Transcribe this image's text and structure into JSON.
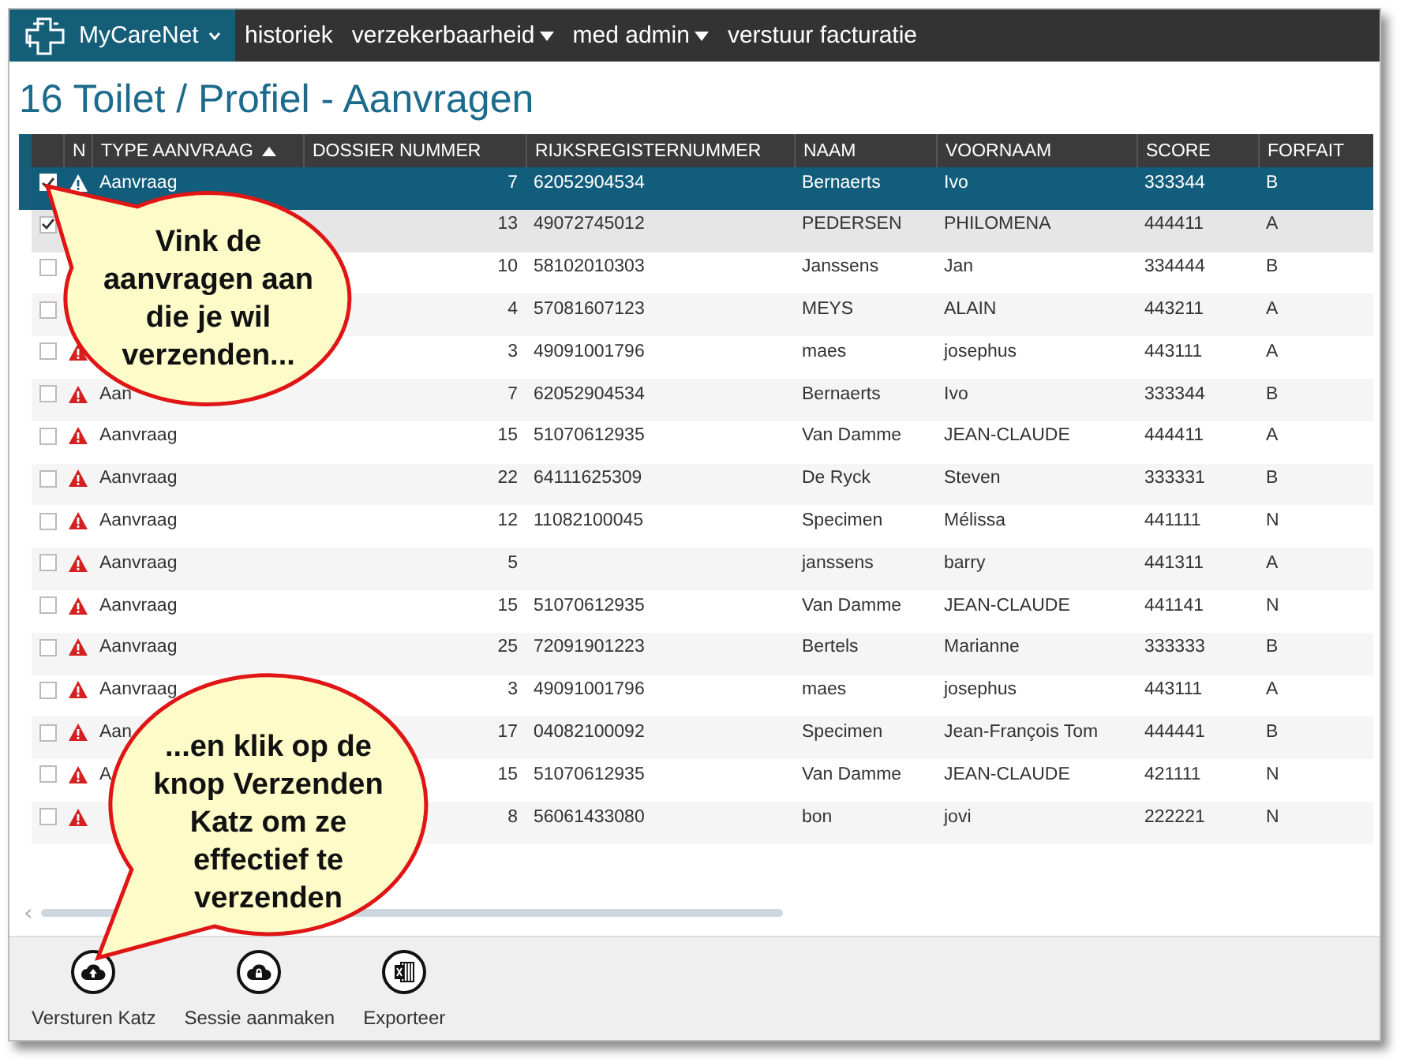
{
  "nav": {
    "brand": "MyCareNet",
    "items": [
      {
        "label": "historiek",
        "dropdown": false
      },
      {
        "label": "verzekerbaarheid",
        "dropdown": true
      },
      {
        "label": "med admin",
        "dropdown": true
      },
      {
        "label": "verstuur facturatie",
        "dropdown": false
      }
    ]
  },
  "title": "16 Toilet / Profiel - Aanvragen",
  "table": {
    "columns": [
      "N",
      "TYPE AANVRAAG",
      "DOSSIER NUMMER",
      "RIJKSREGISTERNUMMER",
      "NAAM",
      "VOORNAAM",
      "SCORE",
      "FORFAIT"
    ],
    "rows": [
      {
        "checked": true,
        "selected": true,
        "hovered": false,
        "warning": true,
        "type": "Aanvraag",
        "dossier": "7",
        "rijks": "62052904534",
        "naam": "Bernaerts",
        "voornaam": "Ivo",
        "score": "333344",
        "forfait": "B"
      },
      {
        "checked": true,
        "selected": false,
        "hovered": true,
        "warning": false,
        "dossier": "13",
        "rijks": "49072745012",
        "naam": "PEDERSEN",
        "voornaam": "PHILOMENA",
        "score": "444411",
        "forfait": "A"
      },
      {
        "checked": false,
        "selected": false,
        "hovered": false,
        "warning": false,
        "dossier": "10",
        "rijks": "58102010303",
        "naam": "Janssens",
        "voornaam": "Jan",
        "score": "334444",
        "forfait": "B"
      },
      {
        "checked": false,
        "selected": false,
        "hovered": false,
        "warning": false,
        "dossier": "4",
        "rijks": "57081607123",
        "naam": "MEYS",
        "voornaam": "ALAIN",
        "score": "443211",
        "forfait": "A"
      },
      {
        "checked": false,
        "selected": false,
        "hovered": false,
        "warning": true,
        "dossier": "3",
        "rijks": "49091001796",
        "naam": "maes",
        "voornaam": "josephus",
        "score": "443111",
        "forfait": "A"
      },
      {
        "checked": false,
        "selected": false,
        "hovered": false,
        "warning": true,
        "type": "Aan",
        "dossier": "7",
        "rijks": "62052904534",
        "naam": "Bernaerts",
        "voornaam": "Ivo",
        "score": "333344",
        "forfait": "B"
      },
      {
        "checked": false,
        "selected": false,
        "hovered": false,
        "warning": true,
        "type": "Aanvraag",
        "dossier": "15",
        "rijks": "51070612935",
        "naam": "Van Damme",
        "voornaam": "JEAN-CLAUDE",
        "score": "444411",
        "forfait": "A"
      },
      {
        "checked": false,
        "selected": false,
        "hovered": false,
        "warning": true,
        "type": "Aanvraag",
        "dossier": "22",
        "rijks": "64111625309",
        "naam": "De Ryck",
        "voornaam": "Steven",
        "score": "333331",
        "forfait": "B"
      },
      {
        "checked": false,
        "selected": false,
        "hovered": false,
        "warning": true,
        "type": "Aanvraag",
        "dossier": "12",
        "rijks": "11082100045",
        "naam": "Specimen",
        "voornaam": "Mélissa",
        "score": "441111",
        "forfait": "N"
      },
      {
        "checked": false,
        "selected": false,
        "hovered": false,
        "warning": true,
        "type": "Aanvraag",
        "dossier": "5",
        "naam": "janssens",
        "voornaam": "barry",
        "score": "441311",
        "forfait": "A"
      },
      {
        "checked": false,
        "selected": false,
        "hovered": false,
        "warning": true,
        "type": "Aanvraag",
        "dossier": "15",
        "rijks": "51070612935",
        "naam": "Van Damme",
        "voornaam": "JEAN-CLAUDE",
        "score": "441141",
        "forfait": "N"
      },
      {
        "checked": false,
        "selected": false,
        "hovered": false,
        "warning": true,
        "type": "Aanvraag",
        "dossier": "25",
        "rijks": "72091901223",
        "naam": "Bertels",
        "voornaam": "Marianne",
        "score": "333333",
        "forfait": "B"
      },
      {
        "checked": false,
        "selected": false,
        "hovered": false,
        "warning": true,
        "type": "Aanvraag",
        "dossier": "3",
        "rijks": "49091001796",
        "naam": "maes",
        "voornaam": "josephus",
        "score": "443111",
        "forfait": "A"
      },
      {
        "checked": false,
        "selected": false,
        "hovered": false,
        "warning": true,
        "type": "Aan",
        "dossier": "17",
        "rijks": "04082100092",
        "naam": "Specimen",
        "voornaam": "Jean-François Tom",
        "score": "444441",
        "forfait": "B"
      },
      {
        "checked": false,
        "selected": false,
        "hovered": false,
        "warning": true,
        "type": "A",
        "dossier": "15",
        "rijks": "51070612935",
        "naam": "Van Damme",
        "voornaam": "JEAN-CLAUDE",
        "score": "421111",
        "forfait": "N"
      },
      {
        "checked": false,
        "selected": false,
        "hovered": false,
        "warning": true,
        "dossier": "8",
        "rijks": "56061433080",
        "naam": "bon",
        "voornaam": "jovi",
        "score": "222221",
        "forfait": "N"
      }
    ]
  },
  "toolbar": [
    {
      "kind": "upload",
      "label": "Versturen Katz"
    },
    {
      "kind": "lock",
      "label": "Sessie aanmaken"
    },
    {
      "kind": "sheet",
      "label": "Exporteer"
    }
  ],
  "callouts": [
    "Vink de aanvragen aan die je wil verzenden...",
    "...en klik op de knop Verzenden Katz om ze effectief te verzenden"
  ]
}
